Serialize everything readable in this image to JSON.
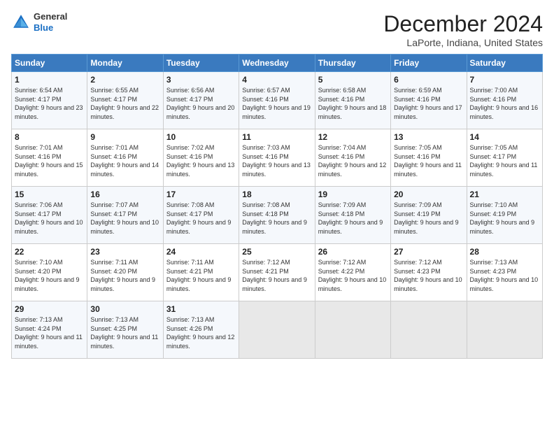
{
  "header": {
    "logo": {
      "general": "General",
      "blue": "Blue"
    },
    "title": "December 2024",
    "location": "LaPorte, Indiana, United States"
  },
  "weekdays": [
    "Sunday",
    "Monday",
    "Tuesday",
    "Wednesday",
    "Thursday",
    "Friday",
    "Saturday"
  ],
  "weeks": [
    [
      {
        "day": "1",
        "sunrise": "6:54 AM",
        "sunset": "4:17 PM",
        "daylight": "9 hours and 23 minutes."
      },
      {
        "day": "2",
        "sunrise": "6:55 AM",
        "sunset": "4:17 PM",
        "daylight": "9 hours and 22 minutes."
      },
      {
        "day": "3",
        "sunrise": "6:56 AM",
        "sunset": "4:17 PM",
        "daylight": "9 hours and 20 minutes."
      },
      {
        "day": "4",
        "sunrise": "6:57 AM",
        "sunset": "4:16 PM",
        "daylight": "9 hours and 19 minutes."
      },
      {
        "day": "5",
        "sunrise": "6:58 AM",
        "sunset": "4:16 PM",
        "daylight": "9 hours and 18 minutes."
      },
      {
        "day": "6",
        "sunrise": "6:59 AM",
        "sunset": "4:16 PM",
        "daylight": "9 hours and 17 minutes."
      },
      {
        "day": "7",
        "sunrise": "7:00 AM",
        "sunset": "4:16 PM",
        "daylight": "9 hours and 16 minutes."
      }
    ],
    [
      {
        "day": "8",
        "sunrise": "7:01 AM",
        "sunset": "4:16 PM",
        "daylight": "9 hours and 15 minutes."
      },
      {
        "day": "9",
        "sunrise": "7:01 AM",
        "sunset": "4:16 PM",
        "daylight": "9 hours and 14 minutes."
      },
      {
        "day": "10",
        "sunrise": "7:02 AM",
        "sunset": "4:16 PM",
        "daylight": "9 hours and 13 minutes."
      },
      {
        "day": "11",
        "sunrise": "7:03 AM",
        "sunset": "4:16 PM",
        "daylight": "9 hours and 13 minutes."
      },
      {
        "day": "12",
        "sunrise": "7:04 AM",
        "sunset": "4:16 PM",
        "daylight": "9 hours and 12 minutes."
      },
      {
        "day": "13",
        "sunrise": "7:05 AM",
        "sunset": "4:16 PM",
        "daylight": "9 hours and 11 minutes."
      },
      {
        "day": "14",
        "sunrise": "7:05 AM",
        "sunset": "4:17 PM",
        "daylight": "9 hours and 11 minutes."
      }
    ],
    [
      {
        "day": "15",
        "sunrise": "7:06 AM",
        "sunset": "4:17 PM",
        "daylight": "9 hours and 10 minutes."
      },
      {
        "day": "16",
        "sunrise": "7:07 AM",
        "sunset": "4:17 PM",
        "daylight": "9 hours and 10 minutes."
      },
      {
        "day": "17",
        "sunrise": "7:08 AM",
        "sunset": "4:17 PM",
        "daylight": "9 hours and 9 minutes."
      },
      {
        "day": "18",
        "sunrise": "7:08 AM",
        "sunset": "4:18 PM",
        "daylight": "9 hours and 9 minutes."
      },
      {
        "day": "19",
        "sunrise": "7:09 AM",
        "sunset": "4:18 PM",
        "daylight": "9 hours and 9 minutes."
      },
      {
        "day": "20",
        "sunrise": "7:09 AM",
        "sunset": "4:19 PM",
        "daylight": "9 hours and 9 minutes."
      },
      {
        "day": "21",
        "sunrise": "7:10 AM",
        "sunset": "4:19 PM",
        "daylight": "9 hours and 9 minutes."
      }
    ],
    [
      {
        "day": "22",
        "sunrise": "7:10 AM",
        "sunset": "4:20 PM",
        "daylight": "9 hours and 9 minutes."
      },
      {
        "day": "23",
        "sunrise": "7:11 AM",
        "sunset": "4:20 PM",
        "daylight": "9 hours and 9 minutes."
      },
      {
        "day": "24",
        "sunrise": "7:11 AM",
        "sunset": "4:21 PM",
        "daylight": "9 hours and 9 minutes."
      },
      {
        "day": "25",
        "sunrise": "7:12 AM",
        "sunset": "4:21 PM",
        "daylight": "9 hours and 9 minutes."
      },
      {
        "day": "26",
        "sunrise": "7:12 AM",
        "sunset": "4:22 PM",
        "daylight": "9 hours and 10 minutes."
      },
      {
        "day": "27",
        "sunrise": "7:12 AM",
        "sunset": "4:23 PM",
        "daylight": "9 hours and 10 minutes."
      },
      {
        "day": "28",
        "sunrise": "7:13 AM",
        "sunset": "4:23 PM",
        "daylight": "9 hours and 10 minutes."
      }
    ],
    [
      {
        "day": "29",
        "sunrise": "7:13 AM",
        "sunset": "4:24 PM",
        "daylight": "9 hours and 11 minutes."
      },
      {
        "day": "30",
        "sunrise": "7:13 AM",
        "sunset": "4:25 PM",
        "daylight": "9 hours and 11 minutes."
      },
      {
        "day": "31",
        "sunrise": "7:13 AM",
        "sunset": "4:26 PM",
        "daylight": "9 hours and 12 minutes."
      },
      null,
      null,
      null,
      null
    ]
  ]
}
